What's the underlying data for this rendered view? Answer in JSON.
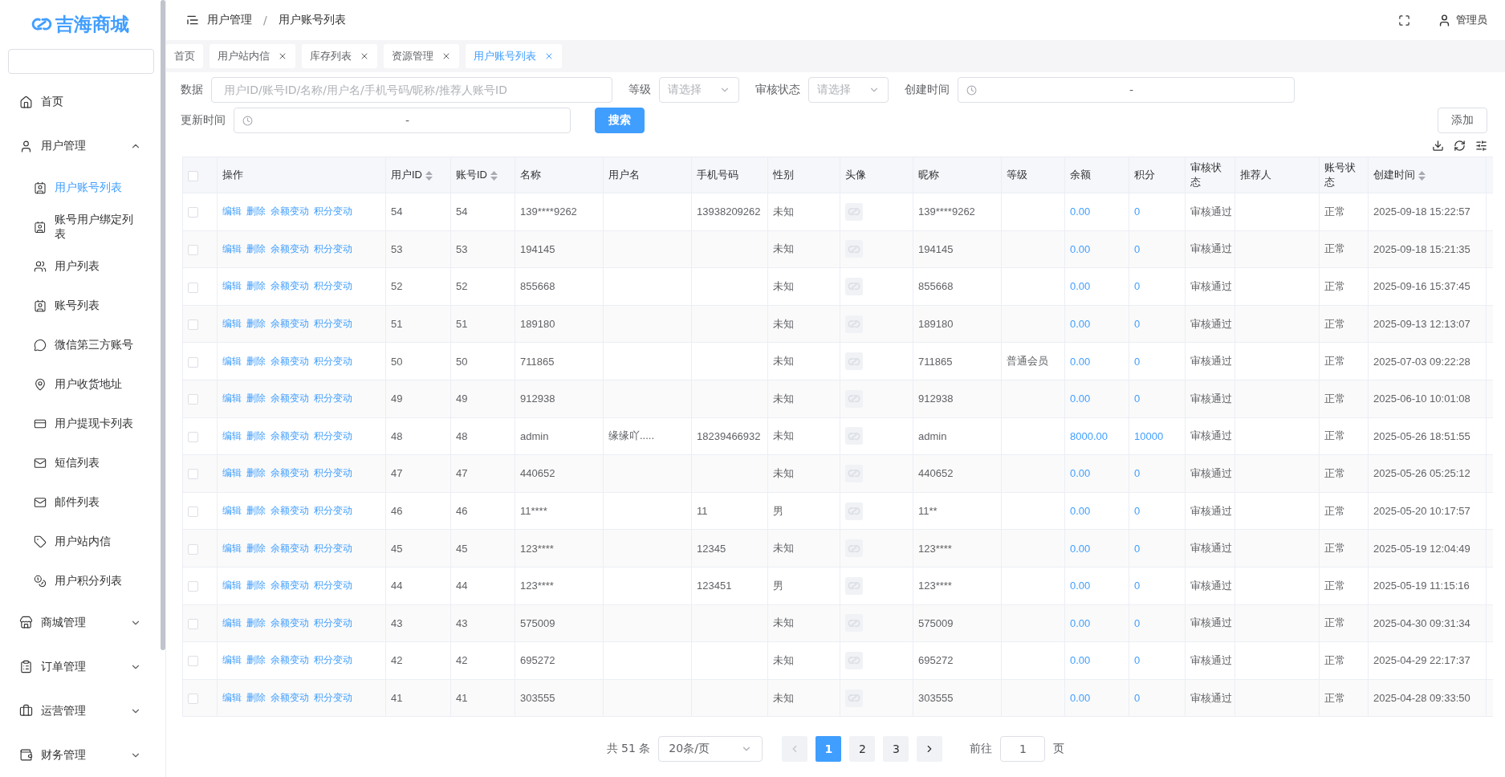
{
  "logo": {
    "text": "吉海商城"
  },
  "sidebar": {
    "items": [
      {
        "label": "首页"
      },
      {
        "label": "用户管理",
        "expanded": true,
        "children": [
          {
            "label": "用户账号列表",
            "selected": true
          },
          {
            "label": "账号用户绑定列表",
            "selected": false
          },
          {
            "label": "用户列表",
            "selected": false
          },
          {
            "label": "账号列表",
            "selected": false
          },
          {
            "label": "微信第三方账号",
            "selected": false
          },
          {
            "label": "用户收货地址",
            "selected": false
          },
          {
            "label": "用户提现卡列表",
            "selected": false
          },
          {
            "label": "短信列表",
            "selected": false
          },
          {
            "label": "邮件列表",
            "selected": false
          },
          {
            "label": "用户站内信",
            "selected": false
          },
          {
            "label": "用户积分列表",
            "selected": false
          }
        ]
      },
      {
        "label": "商城管理",
        "expanded": false
      },
      {
        "label": "订单管理",
        "expanded": false
      },
      {
        "label": "运营管理",
        "expanded": false
      },
      {
        "label": "财务管理",
        "expanded": false
      }
    ]
  },
  "breadcrumb": {
    "items": [
      "用户管理",
      "用户账号列表"
    ],
    "separator": "/"
  },
  "user": {
    "name": "管理员"
  },
  "tabs": [
    {
      "label": "首页",
      "closable": false,
      "selected": false
    },
    {
      "label": "用户站内信",
      "closable": true,
      "selected": false
    },
    {
      "label": "库存列表",
      "closable": true,
      "selected": false
    },
    {
      "label": "资源管理",
      "closable": true,
      "selected": false
    },
    {
      "label": "用户账号列表",
      "closable": true,
      "selected": true
    }
  ],
  "filters": {
    "data": {
      "label": "数据",
      "placeholder": "用户ID/账号ID/名称/用户名/手机号码/昵称/推荐人账号ID"
    },
    "level": {
      "label": "等级",
      "placeholder": "请选择"
    },
    "review_status": {
      "label": "审核状态",
      "placeholder": "请选择"
    },
    "created": {
      "label": "创建时间",
      "separator": "-"
    },
    "updated": {
      "label": "更新时间",
      "separator": "-"
    },
    "search_button": "搜索",
    "add_button": "添加"
  },
  "table": {
    "select_all_checked": false,
    "columns": [
      {
        "label": "操作",
        "sortable": false
      },
      {
        "label": "用户ID",
        "sortable": true
      },
      {
        "label": "账号ID",
        "sortable": true
      },
      {
        "label": "名称",
        "sortable": false
      },
      {
        "label": "用户名",
        "sortable": false
      },
      {
        "label": "手机号码",
        "sortable": false
      },
      {
        "label": "性别",
        "sortable": false
      },
      {
        "label": "头像",
        "sortable": false
      },
      {
        "label": "昵称",
        "sortable": false
      },
      {
        "label": "等级",
        "sortable": false
      },
      {
        "label": "余额",
        "sortable": false
      },
      {
        "label": "积分",
        "sortable": false
      },
      {
        "label": "审核状态",
        "sortable": false
      },
      {
        "label": "推荐人",
        "sortable": false
      },
      {
        "label": "账号状态",
        "sortable": false
      },
      {
        "label": "创建时间",
        "sortable": true
      }
    ],
    "rows": [
      {
        "checked": false,
        "cells": [
          [
            "编辑",
            "删除",
            "余额变动",
            "积分变动"
          ],
          "54",
          "54",
          "139****9262",
          "",
          "13938209262",
          "未知",
          {
            "kind": "avatar"
          },
          "139****9262",
          "",
          "0.00",
          "0",
          "审核通过",
          "",
          "正常",
          "2025-09-18 15:22:57"
        ]
      },
      {
        "checked": false,
        "cells": [
          [
            "编辑",
            "删除",
            "余额变动",
            "积分变动"
          ],
          "53",
          "53",
          "194145",
          "",
          "",
          "未知",
          {
            "kind": "avatar"
          },
          "194145",
          "",
          "0.00",
          "0",
          "审核通过",
          "",
          "正常",
          "2025-09-18 15:21:35"
        ]
      },
      {
        "checked": false,
        "cells": [
          [
            "编辑",
            "删除",
            "余额变动",
            "积分变动"
          ],
          "52",
          "52",
          "855668",
          "",
          "",
          "未知",
          {
            "kind": "avatar"
          },
          "855668",
          "",
          "0.00",
          "0",
          "审核通过",
          "",
          "正常",
          "2025-09-16 15:37:45"
        ]
      },
      {
        "checked": false,
        "cells": [
          [
            "编辑",
            "删除",
            "余额变动",
            "积分变动"
          ],
          "51",
          "51",
          "189180",
          "",
          "",
          "未知",
          {
            "kind": "avatar"
          },
          "189180",
          "",
          "0.00",
          "0",
          "审核通过",
          "",
          "正常",
          "2025-09-13 12:13:07"
        ]
      },
      {
        "checked": false,
        "cells": [
          [
            "编辑",
            "删除",
            "余额变动",
            "积分变动"
          ],
          "50",
          "50",
          "711865",
          "",
          "",
          "未知",
          {
            "kind": "avatar"
          },
          "711865",
          "普通会员",
          "0.00",
          "0",
          "审核通过",
          "",
          "正常",
          "2025-07-03 09:22:28"
        ]
      },
      {
        "checked": false,
        "cells": [
          [
            "编辑",
            "删除",
            "余额变动",
            "积分变动"
          ],
          "49",
          "49",
          "912938",
          "",
          "",
          "未知",
          {
            "kind": "avatar"
          },
          "912938",
          "",
          "0.00",
          "0",
          "审核通过",
          "",
          "正常",
          "2025-06-10 10:01:08"
        ]
      },
      {
        "checked": false,
        "cells": [
          [
            "编辑",
            "删除",
            "余额变动",
            "积分变动"
          ],
          "48",
          "48",
          "admin",
          "缘缘吖.....",
          "18239466932",
          "未知",
          {
            "kind": "avatar"
          },
          "admin",
          "",
          "8000.00",
          "10000",
          "审核通过",
          "",
          "正常",
          "2025-05-26 18:51:55"
        ]
      },
      {
        "checked": false,
        "cells": [
          [
            "编辑",
            "删除",
            "余额变动",
            "积分变动"
          ],
          "47",
          "47",
          "440652",
          "",
          "",
          "未知",
          {
            "kind": "avatar"
          },
          "440652",
          "",
          "0.00",
          "0",
          "审核通过",
          "",
          "正常",
          "2025-05-26 05:25:12"
        ]
      },
      {
        "checked": false,
        "cells": [
          [
            "编辑",
            "删除",
            "余额变动",
            "积分变动"
          ],
          "46",
          "46",
          "11****",
          "",
          "11",
          "男",
          {
            "kind": "avatar"
          },
          "11**",
          "",
          "0.00",
          "0",
          "审核通过",
          "",
          "正常",
          "2025-05-20 10:17:57"
        ]
      },
      {
        "checked": false,
        "cells": [
          [
            "编辑",
            "删除",
            "余额变动",
            "积分变动"
          ],
          "45",
          "45",
          "123****",
          "",
          "12345",
          "未知",
          {
            "kind": "avatar"
          },
          "123****",
          "",
          "0.00",
          "0",
          "审核通过",
          "",
          "正常",
          "2025-05-19 12:04:49"
        ]
      },
      {
        "checked": false,
        "cells": [
          [
            "编辑",
            "删除",
            "余额变动",
            "积分变动"
          ],
          "44",
          "44",
          "123****",
          "",
          "123451",
          "男",
          {
            "kind": "avatar"
          },
          "123****",
          "",
          "0.00",
          "0",
          "审核通过",
          "",
          "正常",
          "2025-05-19 11:15:16"
        ]
      },
      {
        "checked": false,
        "cells": [
          [
            "编辑",
            "删除",
            "余额变动",
            "积分变动"
          ],
          "43",
          "43",
          "575009",
          "",
          "",
          "未知",
          {
            "kind": "avatar"
          },
          "575009",
          "",
          "0.00",
          "0",
          "审核通过",
          "",
          "正常",
          "2025-04-30 09:31:34"
        ]
      },
      {
        "checked": false,
        "cells": [
          [
            "编辑",
            "删除",
            "余额变动",
            "积分变动"
          ],
          "42",
          "42",
          "695272",
          "",
          "",
          "未知",
          {
            "kind": "avatar"
          },
          "695272",
          "",
          "0.00",
          "0",
          "审核通过",
          "",
          "正常",
          "2025-04-29 22:17:37"
        ]
      },
      {
        "checked": false,
        "cells": [
          [
            "编辑",
            "删除",
            "余额变动",
            "积分变动"
          ],
          "41",
          "41",
          "303555",
          "",
          "",
          "未知",
          {
            "kind": "avatar"
          },
          "303555",
          "",
          "0.00",
          "0",
          "审核通过",
          "",
          "正常",
          "2025-04-28 09:33:50"
        ]
      }
    ]
  },
  "pagination": {
    "total": "共 51 条",
    "page_size": "20条/页",
    "prev_disabled": true,
    "next_disabled": false,
    "pages": [
      {
        "label": "1",
        "selected": true
      },
      {
        "label": "2",
        "selected": false
      },
      {
        "label": "3",
        "selected": false
      }
    ],
    "goto_label": "前往",
    "goto_value": "1",
    "goto_suffix": "页"
  }
}
